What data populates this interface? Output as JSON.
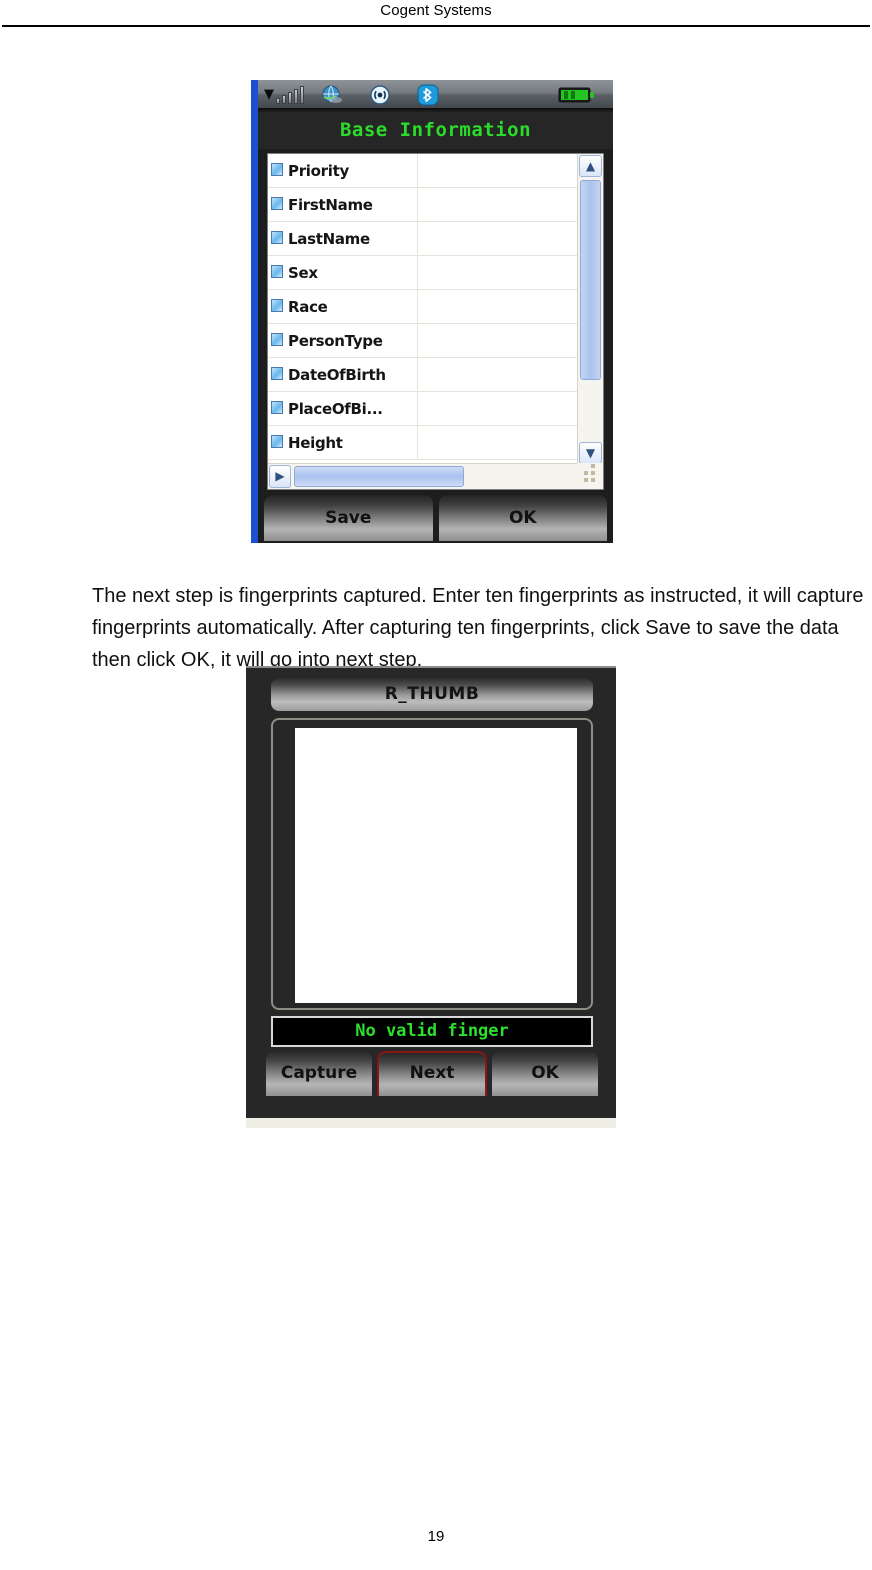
{
  "document": {
    "header_title": "Cogent Systems",
    "page_number": "19",
    "paragraph": "The next step is fingerprints captured. Enter ten fingerprints as instructed, it will capture fingerprints automatically. After capturing ten fingerprints, click Save to save the data then click OK, it will go into next step."
  },
  "colors": {
    "lcd_green": "#2bdc2b",
    "status_green": "#2ee02e",
    "title_bar_bg": "#262626",
    "device_bezel": "#1d1d1d",
    "blue_edge": "#1c4fd4",
    "focus_red": "#8b1515",
    "battery_green": "#22c522",
    "bluetooth_blue": "#1e9bdd"
  },
  "screenshot_base_information": {
    "statusbar": {
      "icons": [
        {
          "name": "signal-strength-icon",
          "label": "Signal"
        },
        {
          "name": "network-globe-icon",
          "label": "Network"
        },
        {
          "name": "wireless-radio-icon",
          "label": "Wireless"
        },
        {
          "name": "bluetooth-icon",
          "label": "Bluetooth"
        },
        {
          "name": "battery-icon",
          "label": "Battery"
        }
      ]
    },
    "title": "Base Information",
    "grid": {
      "rows": [
        {
          "field": "Priority",
          "value": ""
        },
        {
          "field": "FirstName",
          "value": ""
        },
        {
          "field": "LastName",
          "value": ""
        },
        {
          "field": "Sex",
          "value": ""
        },
        {
          "field": "Race",
          "value": ""
        },
        {
          "field": "PersonType",
          "value": ""
        },
        {
          "field": "DateOfBirth",
          "value": ""
        },
        {
          "field": "PlaceOfBi...",
          "value": ""
        },
        {
          "field": "Height",
          "value": ""
        }
      ],
      "scroll_up_glyph": "▲",
      "scroll_down_glyph": "▼",
      "scroll_left_glyph": "◀",
      "scroll_right_glyph": "▶"
    },
    "buttons": [
      {
        "label": "Save"
      },
      {
        "label": "OK"
      }
    ]
  },
  "screenshot_fingerprint_capture": {
    "title": "R_THUMB",
    "status_message": "No valid finger",
    "buttons": [
      {
        "label": "Capture",
        "focused": false
      },
      {
        "label": "Next",
        "focused": true
      },
      {
        "label": "OK",
        "focused": false
      }
    ]
  }
}
